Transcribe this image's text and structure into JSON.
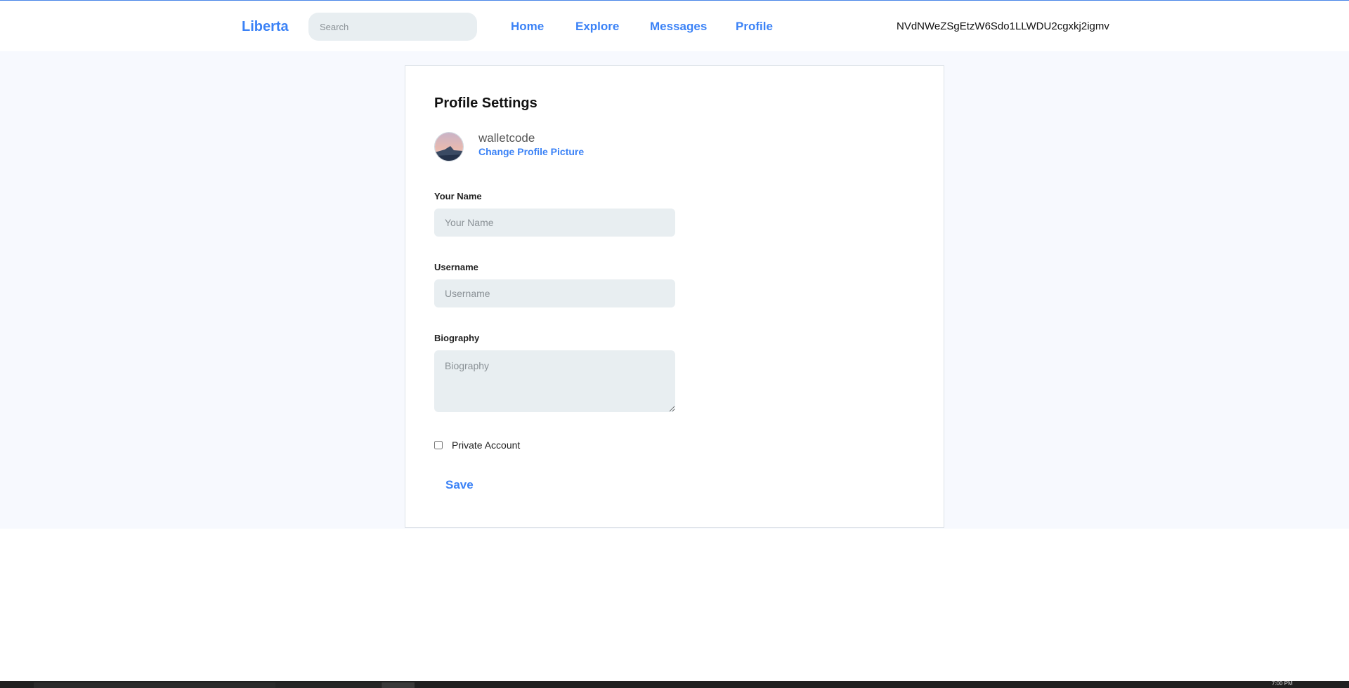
{
  "nav": {
    "brand": "Liberta",
    "search_placeholder": "Search",
    "links": [
      "Home",
      "Explore",
      "Messages",
      "Profile"
    ],
    "user_id": "NVdNWeZSgEtzW6Sdo1LLWDU2cgxkj2igmv"
  },
  "settings": {
    "title": "Profile Settings",
    "username": "walletcode",
    "change_picture": "Change Profile Picture",
    "fields": {
      "name_label": "Your Name",
      "name_placeholder": "Your Name",
      "username_label": "Username",
      "username_placeholder": "Username",
      "bio_label": "Biography",
      "bio_placeholder": "Biography"
    },
    "private_label": "Private Account",
    "private_checked": false,
    "save_label": "Save"
  },
  "colors": {
    "accent": "#3b82f6",
    "input_bg": "#e8eef1",
    "page_bg": "#f7f9fe"
  },
  "taskbar": {
    "clock": "7:00 PM"
  }
}
